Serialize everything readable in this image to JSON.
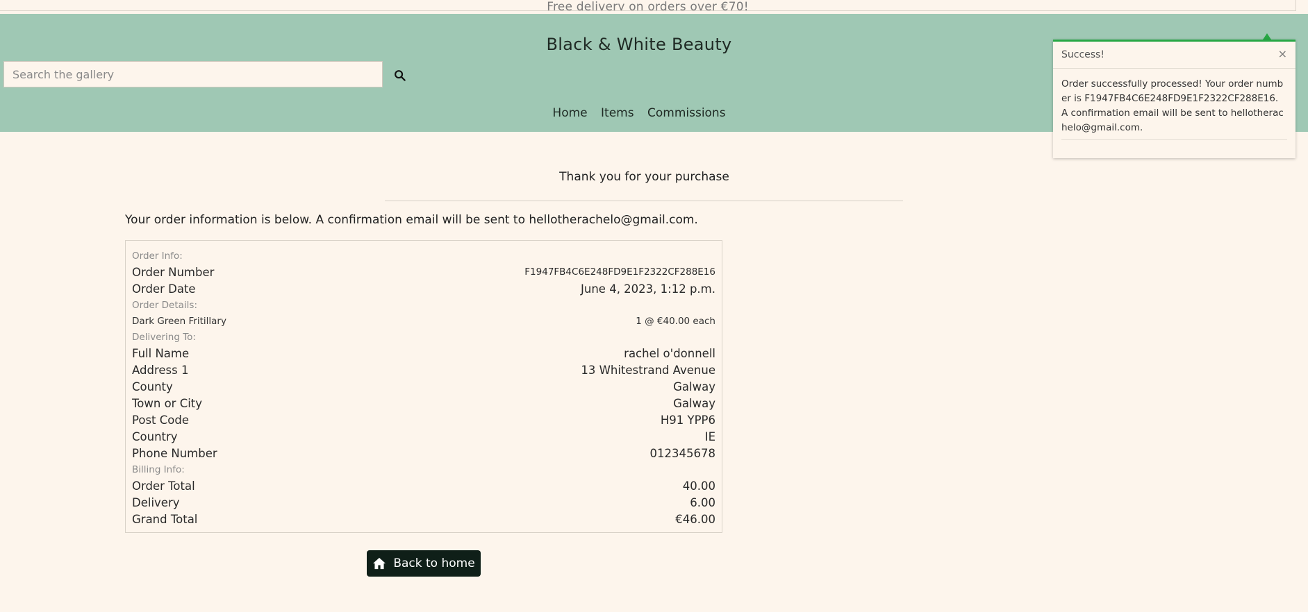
{
  "banner": {
    "text": "Free delivery on orders over €70!"
  },
  "header": {
    "site_title": "Black & White Beauty",
    "search_placeholder": "Search the gallery",
    "nav": [
      "Home",
      "Items",
      "Commissions"
    ]
  },
  "toast": {
    "title": "Success!",
    "close": "×",
    "message": "Order successfully processed! Your order number is F1947FB4C6E248FD9E1F2322CF288E16. A confirmation email will be sent to hellotherachelo@gmail.com."
  },
  "main": {
    "thanks": "Thank you for your purchase",
    "intro": "Your order information is below. A confirmation email will be sent to hellotherachelo@gmail.com.",
    "order_info_label": "Order Info:",
    "order_number_label": "Order Number",
    "order_number": "F1947FB4C6E248FD9E1F2322CF288E16",
    "order_date_label": "Order Date",
    "order_date": "June 4, 2023, 1:12 p.m.",
    "order_details_label": "Order Details:",
    "item_name": "Dark Green Fritillary",
    "item_qty": "1 @ €40.00 each",
    "delivering_label": "Delivering To:",
    "full_name_label": "Full Name",
    "full_name": "rachel o'donnell",
    "address1_label": "Address 1",
    "address1": "13 Whitestrand Avenue",
    "county_label": "County",
    "county": "Galway",
    "town_label": "Town or City",
    "town": "Galway",
    "postcode_label": "Post Code",
    "postcode": "H91 YPP6",
    "country_label": "Country",
    "country": "IE",
    "phone_label": "Phone Number",
    "phone": "012345678",
    "billing_label": "Billing Info:",
    "order_total_label": "Order Total",
    "order_total": "40.00",
    "delivery_label": "Delivery",
    "delivery": "6.00",
    "grand_total_label": "Grand Total",
    "grand_total": "€46.00",
    "back_button": "Back to home"
  },
  "colors": {
    "header_bg": "#9fc8b4",
    "page_bg": "#fdf5ec",
    "success": "#28a745",
    "button_bg": "#0f1f18"
  }
}
